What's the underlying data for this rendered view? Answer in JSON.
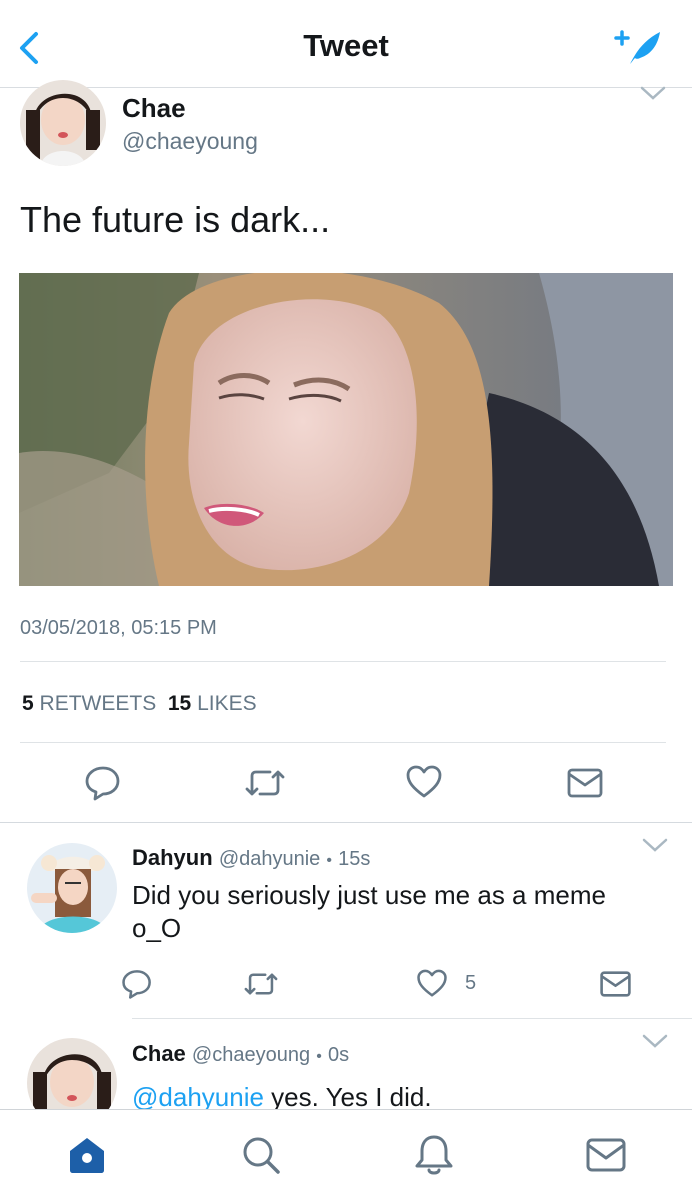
{
  "nav": {
    "title": "Tweet"
  },
  "tweet": {
    "name": "Chae",
    "handle": "@chaeyoung",
    "text": "The future is dark...",
    "timestamp": "03/05/2018, 05:15 PM",
    "retweets_count": "5",
    "retweets_label": "RETWEETS",
    "likes_count": "15",
    "likes_label": "LIKES"
  },
  "replies": [
    {
      "name": "Dahyun",
      "handle": "@dahyunie",
      "dot": "•",
      "time": "15s",
      "text_line1": "Did you seriously just use me as a meme",
      "text_line2": "o_O",
      "like_count": "5"
    },
    {
      "name": "Chae",
      "handle": "@chaeyoung",
      "dot": "•",
      "time": "0s",
      "mention": "@dahyunie",
      "text": " yes. Yes I did."
    }
  ],
  "colors": {
    "accent": "#1da1f2",
    "muted": "#657786",
    "tab_active": "#1d5fa8"
  },
  "icons": [
    "back-icon",
    "compose-icon",
    "chevron-down-icon",
    "reply-icon",
    "retweet-icon",
    "like-icon",
    "message-icon",
    "home-icon",
    "search-icon",
    "bell-icon",
    "mail-icon"
  ]
}
